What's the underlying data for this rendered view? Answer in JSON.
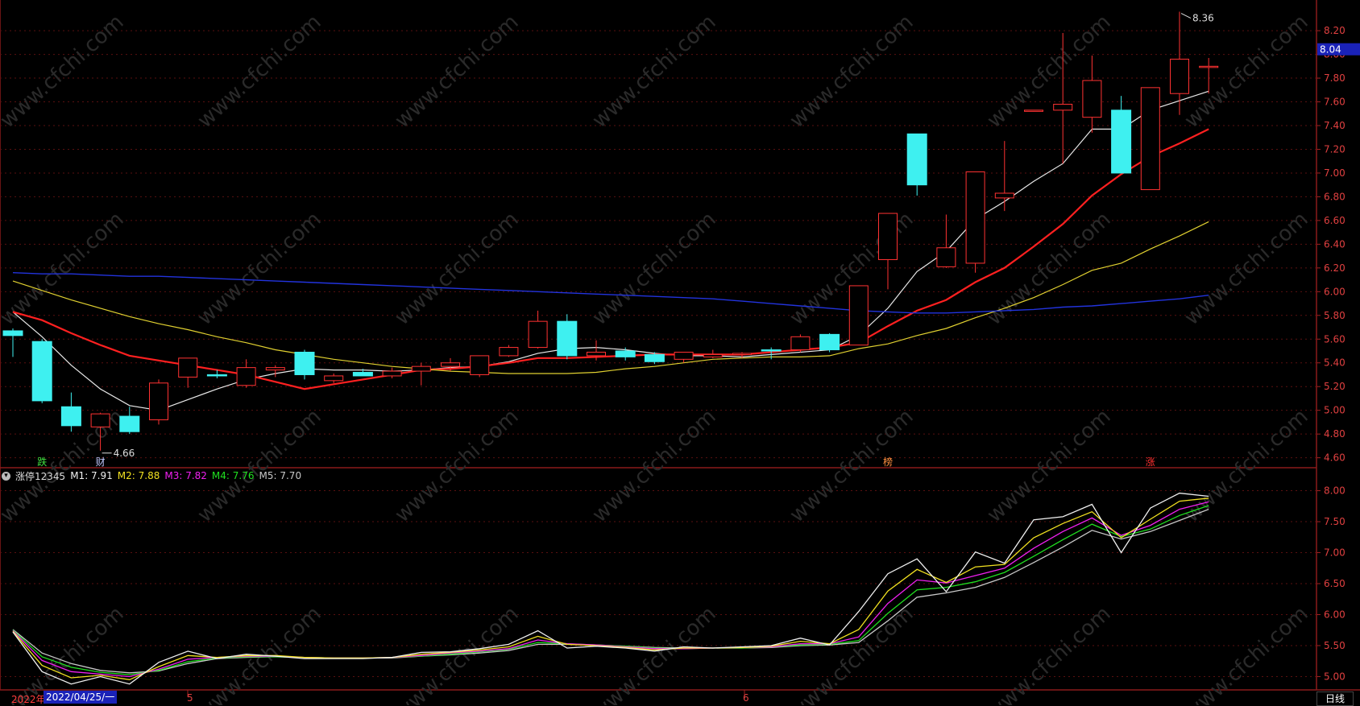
{
  "chart_data": [
    {
      "type": "candlestick",
      "price_ticks": [
        "8.20",
        "8.00",
        "7.80",
        "7.60",
        "7.40",
        "7.20",
        "7.00",
        "6.80",
        "6.60",
        "6.40",
        "6.20",
        "6.00",
        "5.80",
        "5.60",
        "5.40",
        "5.20",
        "5.00",
        "4.80",
        "4.60"
      ],
      "ylim": [
        4.55,
        8.35
      ],
      "current_price": "8.04",
      "high_label": "8.36",
      "low_label": "4.66",
      "candles": [
        {
          "o": 5.67,
          "h": 5.69,
          "l": 5.45,
          "c": 5.63
        },
        {
          "o": 5.58,
          "h": 5.6,
          "l": 5.06,
          "c": 5.08
        },
        {
          "o": 5.03,
          "h": 5.15,
          "l": 4.82,
          "c": 4.87
        },
        {
          "o": 4.86,
          "h": 4.98,
          "l": 4.66,
          "c": 4.97
        },
        {
          "o": 4.95,
          "h": 5.03,
          "l": 4.8,
          "c": 4.82
        },
        {
          "o": 4.92,
          "h": 5.26,
          "l": 4.88,
          "c": 5.23
        },
        {
          "o": 5.28,
          "h": 5.39,
          "l": 5.19,
          "c": 5.44
        },
        {
          "o": 5.3,
          "h": 5.34,
          "l": 5.27,
          "c": 5.29
        },
        {
          "o": 5.21,
          "h": 5.43,
          "l": 5.19,
          "c": 5.36
        },
        {
          "o": 5.34,
          "h": 5.38,
          "l": 5.28,
          "c": 5.36
        },
        {
          "o": 5.49,
          "h": 5.51,
          "l": 5.26,
          "c": 5.3
        },
        {
          "o": 5.25,
          "h": 5.31,
          "l": 5.23,
          "c": 5.29
        },
        {
          "o": 5.32,
          "h": 5.35,
          "l": 5.29,
          "c": 5.29
        },
        {
          "o": 5.29,
          "h": 5.36,
          "l": 5.27,
          "c": 5.33
        },
        {
          "o": 5.33,
          "h": 5.4,
          "l": 5.21,
          "c": 5.37
        },
        {
          "o": 5.37,
          "h": 5.44,
          "l": 5.33,
          "c": 5.4
        },
        {
          "o": 5.3,
          "h": 5.45,
          "l": 5.28,
          "c": 5.46
        },
        {
          "o": 5.46,
          "h": 5.55,
          "l": 5.45,
          "c": 5.53
        },
        {
          "o": 5.53,
          "h": 5.84,
          "l": 5.52,
          "c": 5.75
        },
        {
          "o": 5.75,
          "h": 5.81,
          "l": 5.43,
          "c": 5.46
        },
        {
          "o": 5.46,
          "h": 5.59,
          "l": 5.42,
          "c": 5.49
        },
        {
          "o": 5.5,
          "h": 5.53,
          "l": 5.42,
          "c": 5.45
        },
        {
          "o": 5.47,
          "h": 5.49,
          "l": 5.39,
          "c": 5.41
        },
        {
          "o": 5.43,
          "h": 5.48,
          "l": 5.4,
          "c": 5.49
        },
        {
          "o": 5.45,
          "h": 5.51,
          "l": 5.44,
          "c": 5.47
        },
        {
          "o": 5.47,
          "h": 5.49,
          "l": 5.44,
          "c": 5.48
        },
        {
          "o": 5.51,
          "h": 5.53,
          "l": 5.43,
          "c": 5.5
        },
        {
          "o": 5.51,
          "h": 5.64,
          "l": 5.49,
          "c": 5.62
        },
        {
          "o": 5.64,
          "h": 5.65,
          "l": 5.49,
          "c": 5.51
        },
        {
          "o": 5.55,
          "h": 6.05,
          "l": 5.55,
          "c": 6.05
        },
        {
          "o": 6.27,
          "h": 6.66,
          "l": 6.02,
          "c": 6.66
        },
        {
          "o": 7.33,
          "h": 7.33,
          "l": 6.81,
          "c": 6.9
        },
        {
          "o": 6.21,
          "h": 6.65,
          "l": 6.2,
          "c": 6.37
        },
        {
          "o": 6.24,
          "h": 7.01,
          "l": 6.16,
          "c": 7.01
        },
        {
          "o": 6.79,
          "h": 7.27,
          "l": 6.68,
          "c": 6.83
        },
        {
          "o": 7.53,
          "h": 7.53,
          "l": 7.53,
          "c": 7.53
        },
        {
          "o": 7.53,
          "h": 8.18,
          "l": 7.08,
          "c": 7.58
        },
        {
          "o": 7.47,
          "h": 7.99,
          "l": 7.34,
          "c": 7.78
        },
        {
          "o": 7.53,
          "h": 7.65,
          "l": 7.0,
          "c": 7.0
        },
        {
          "o": 6.86,
          "h": 7.72,
          "l": 6.86,
          "c": 7.72
        },
        {
          "o": 7.67,
          "h": 8.36,
          "l": 7.49,
          "c": 7.96
        },
        {
          "o": 7.9,
          "h": 7.97,
          "l": 7.67,
          "c": 7.9
        }
      ],
      "ma_lines": [
        {
          "color": "#e8e8e8",
          "width": 1.2,
          "values": [
            5.83,
            5.62,
            5.38,
            5.18,
            5.04,
            5.0,
            5.09,
            5.18,
            5.26,
            5.31,
            5.35,
            5.34,
            5.34,
            5.33,
            5.34,
            5.36,
            5.37,
            5.41,
            5.48,
            5.52,
            5.53,
            5.51,
            5.48,
            5.46,
            5.46,
            5.45,
            5.47,
            5.49,
            5.51,
            5.63,
            5.86,
            6.17,
            6.34,
            6.61,
            6.76,
            6.93,
            7.08,
            7.37,
            7.37,
            7.53,
            7.61,
            7.69
          ]
        },
        {
          "color": "#ff2020",
          "width": 2.2,
          "values": [
            5.83,
            5.76,
            5.65,
            5.55,
            5.46,
            5.42,
            5.38,
            5.34,
            5.3,
            5.24,
            5.18,
            5.22,
            5.26,
            5.3,
            5.34,
            5.35,
            5.37,
            5.4,
            5.44,
            5.44,
            5.45,
            5.46,
            5.47,
            5.47,
            5.47,
            5.47,
            5.49,
            5.51,
            5.53,
            5.57,
            5.71,
            5.84,
            5.93,
            6.08,
            6.2,
            6.38,
            6.57,
            6.81,
            6.99,
            7.14,
            7.25,
            7.37
          ]
        },
        {
          "color": "#e0d030",
          "width": 1.2,
          "values": [
            6.09,
            6.01,
            5.93,
            5.86,
            5.79,
            5.73,
            5.68,
            5.62,
            5.57,
            5.51,
            5.47,
            5.43,
            5.4,
            5.37,
            5.35,
            5.33,
            5.32,
            5.31,
            5.31,
            5.31,
            5.32,
            5.35,
            5.37,
            5.4,
            5.43,
            5.44,
            5.45,
            5.45,
            5.46,
            5.52,
            5.56,
            5.63,
            5.69,
            5.78,
            5.86,
            5.95,
            6.06,
            6.18,
            6.24,
            6.36,
            6.47,
            6.59
          ]
        },
        {
          "color": "#2233dd",
          "width": 1.4,
          "values": [
            6.16,
            6.15,
            6.15,
            6.14,
            6.13,
            6.13,
            6.12,
            6.11,
            6.1,
            6.09,
            6.08,
            6.07,
            6.06,
            6.05,
            6.04,
            6.03,
            6.02,
            6.01,
            6.0,
            5.99,
            5.98,
            5.97,
            5.96,
            5.95,
            5.94,
            5.92,
            5.9,
            5.88,
            5.86,
            5.84,
            5.83,
            5.82,
            5.82,
            5.83,
            5.84,
            5.85,
            5.87,
            5.88,
            5.9,
            5.92,
            5.94,
            5.97
          ]
        }
      ],
      "markers": [
        {
          "index": 1,
          "text": "跌",
          "color": "#40e040"
        },
        {
          "index": 3,
          "text": "财",
          "color": "#c0c8ff"
        },
        {
          "index": 30,
          "text": "榜",
          "color": "#ff9040"
        },
        {
          "index": 39,
          "text": "涨",
          "color": "#ff3030"
        }
      ]
    },
    {
      "type": "line",
      "title": "涨停12345",
      "yticks": [
        "8.00",
        "7.50",
        "7.00",
        "6.50",
        "6.00",
        "5.50",
        "5.00"
      ],
      "ylim": [
        4.85,
        8.15
      ],
      "series": [
        {
          "name": "M1",
          "label_value": "7.91",
          "color": "#f0f0f0",
          "values": [
            5.72,
            5.08,
            4.88,
            5.0,
            4.88,
            5.23,
            5.41,
            5.29,
            5.36,
            5.33,
            5.29,
            5.29,
            5.29,
            5.31,
            5.39,
            5.4,
            5.45,
            5.52,
            5.74,
            5.46,
            5.49,
            5.46,
            5.41,
            5.48,
            5.46,
            5.48,
            5.5,
            5.62,
            5.51,
            6.05,
            6.66,
            6.9,
            6.37,
            7.01,
            6.83,
            7.53,
            7.58,
            7.78,
            7.0,
            7.72,
            7.96,
            7.91
          ]
        },
        {
          "name": "M2",
          "label_value": "7.88",
          "color": "#f0e020",
          "values": [
            5.73,
            5.18,
            4.98,
            5.02,
            4.95,
            5.16,
            5.34,
            5.31,
            5.34,
            5.34,
            5.31,
            5.3,
            5.3,
            5.31,
            5.36,
            5.39,
            5.43,
            5.48,
            5.65,
            5.52,
            5.5,
            5.47,
            5.43,
            5.46,
            5.46,
            5.47,
            5.49,
            5.57,
            5.53,
            5.76,
            6.38,
            6.73,
            6.52,
            6.77,
            6.81,
            7.24,
            7.47,
            7.66,
            7.24,
            7.54,
            7.83,
            7.88
          ]
        },
        {
          "name": "M3",
          "label_value": "7.82",
          "color": "#f020f0",
          "values": [
            5.74,
            5.26,
            5.08,
            5.04,
            5.0,
            5.12,
            5.28,
            5.31,
            5.33,
            5.33,
            5.31,
            5.3,
            5.3,
            5.31,
            5.34,
            5.38,
            5.41,
            5.45,
            5.59,
            5.53,
            5.51,
            5.48,
            5.45,
            5.45,
            5.46,
            5.47,
            5.48,
            5.53,
            5.53,
            5.64,
            6.18,
            6.56,
            6.51,
            6.63,
            6.75,
            7.07,
            7.34,
            7.56,
            7.28,
            7.44,
            7.7,
            7.82
          ]
        },
        {
          "name": "M4",
          "label_value": "7.76",
          "color": "#20e020",
          "values": [
            5.75,
            5.32,
            5.15,
            5.07,
            5.03,
            5.1,
            5.24,
            5.3,
            5.32,
            5.32,
            5.31,
            5.3,
            5.3,
            5.31,
            5.33,
            5.36,
            5.4,
            5.44,
            5.55,
            5.53,
            5.51,
            5.49,
            5.46,
            5.45,
            5.46,
            5.46,
            5.48,
            5.51,
            5.52,
            5.58,
            6.02,
            6.4,
            6.44,
            6.53,
            6.68,
            6.94,
            7.21,
            7.46,
            7.26,
            7.38,
            7.6,
            7.76
          ]
        },
        {
          "name": "M5",
          "label_value": "7.70",
          "color": "#c8c8c8",
          "values": [
            5.76,
            5.38,
            5.21,
            5.1,
            5.06,
            5.09,
            5.21,
            5.29,
            5.31,
            5.32,
            5.31,
            5.3,
            5.3,
            5.3,
            5.33,
            5.35,
            5.38,
            5.42,
            5.52,
            5.52,
            5.51,
            5.49,
            5.47,
            5.46,
            5.46,
            5.46,
            5.47,
            5.5,
            5.51,
            5.55,
            5.9,
            6.28,
            6.35,
            6.44,
            6.6,
            6.84,
            7.09,
            7.36,
            7.22,
            7.34,
            7.52,
            7.7
          ]
        }
      ]
    }
  ],
  "footer": {
    "year": "2022年",
    "cursor_date": "2022/04/25/一",
    "month_5": "5",
    "month_6": "6",
    "period": "日线"
  }
}
